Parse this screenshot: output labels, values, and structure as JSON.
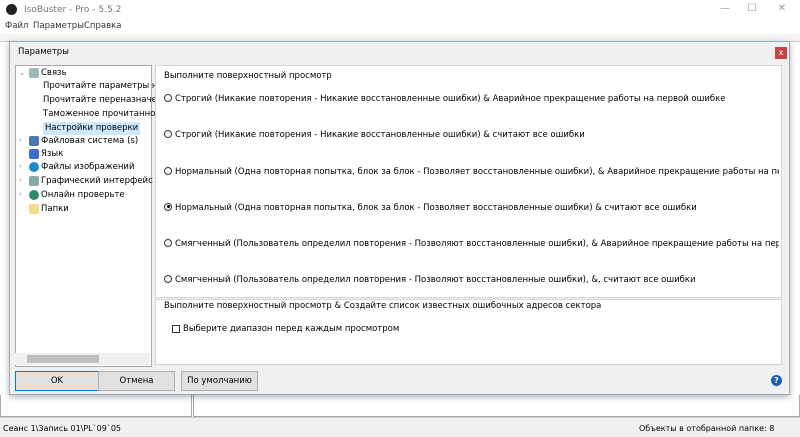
{
  "app": {
    "title": "IsoBuster - Pro - 5.5.2",
    "menu": [
      "Файл",
      "Параметры",
      "Справка"
    ]
  },
  "dialog": {
    "title": "Параметры",
    "close": "x",
    "tree": [
      {
        "label": "Связь",
        "level": 0
      },
      {
        "label": "Прочитайте параметры н",
        "level": 1
      },
      {
        "label": "Прочитайте переназначе",
        "level": 1
      },
      {
        "label": "Таможенное прочитанное",
        "level": 1
      },
      {
        "label": "Настройки проверки",
        "level": 1,
        "selected": true
      },
      {
        "label": "Файловая система (s)",
        "level": 0
      },
      {
        "label": "Язык",
        "level": 0
      },
      {
        "label": "Файлы изображений",
        "level": 0
      },
      {
        "label": "Графический интерфейс п",
        "level": 0
      },
      {
        "label": "Онлайн проверьте",
        "level": 0
      },
      {
        "label": "Папки",
        "level": 0
      }
    ],
    "group1": {
      "title": "Выполните поверхностный просмотр",
      "options": [
        "Строгий (Никакие повторения - Никакие восстановленные ошибки) & Аварийное прекращение работы на первой ошибке",
        "Строгий (Никакие повторения - Никакие восстановленные ошибки) & считают все ошибки",
        "Нормальный (Одна повторная попытка, блок за блок - Позволяет восстановленные ошибки), & Аварийное прекращение работы на первой ошибке",
        "Нормальный (Одна повторная попытка, блок за блок - Позволяет восстановленные ошибки) & считают все ошибки",
        "Смягченный (Пользователь определил повторения - Позволяют восстановленные ошибки), & Аварийное прекращение работы на первой ошибке",
        "Смягченный (Пользователь определил повторения - Позволяют восстановленные ошибки), &, считают все ошибки"
      ],
      "selected": 3
    },
    "group2": {
      "title": "Выполните поверхностный просмотр & Создайте список известных ошибочных адресов сектора",
      "checkbox": "Выберите диапазон перед каждым просмотром",
      "checked": false
    },
    "buttons": {
      "ok": "OK",
      "cancel": "Отмена",
      "default": "По умолчанию",
      "help": "?"
    }
  },
  "status": {
    "left": "Сеанс 1\\Запись 01\\PL`09`05",
    "right": "Объекты в отобранной папке: 8"
  }
}
